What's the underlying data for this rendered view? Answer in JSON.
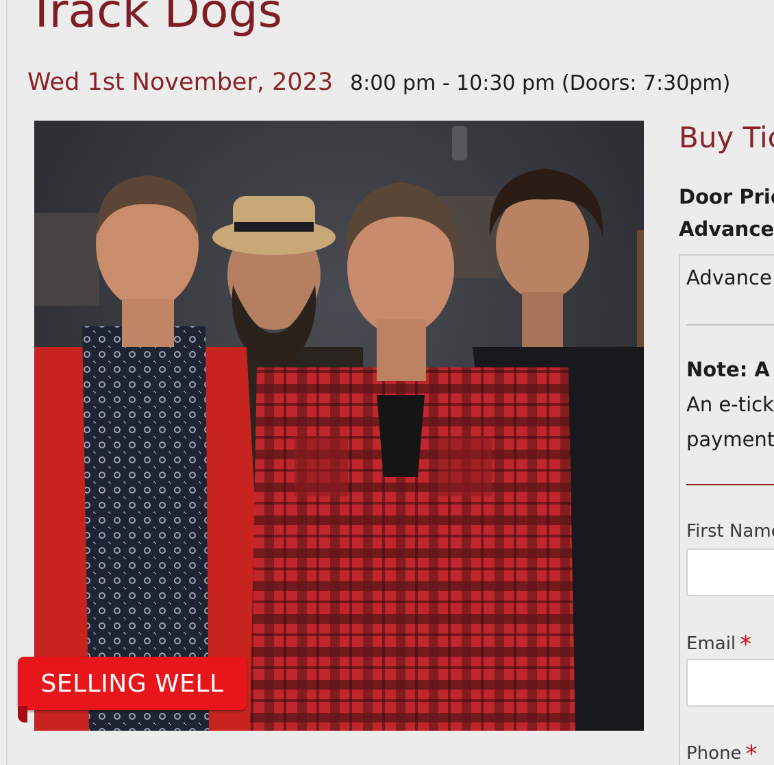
{
  "event": {
    "title": "Track Dogs",
    "date": "Wed 1st November, 2023",
    "time": "8:00 pm - 10:30 pm (Doors: 7:30pm)",
    "badge": "SELLING WELL"
  },
  "tickets": {
    "heading": "Buy Tic",
    "door_price_label": "Door Pric",
    "advance_label": "Advance:",
    "box_option": "Advance",
    "note_title": "Note: A",
    "note_line1": "An e-tick",
    "note_line2": "payment"
  },
  "form": {
    "first_name_label": "First Name",
    "email_label": "Email",
    "phone_label": "Phone",
    "required_mark": "*"
  },
  "colors": {
    "accent": "#8a2227",
    "badge": "#e8151b",
    "background": "#ececec"
  }
}
